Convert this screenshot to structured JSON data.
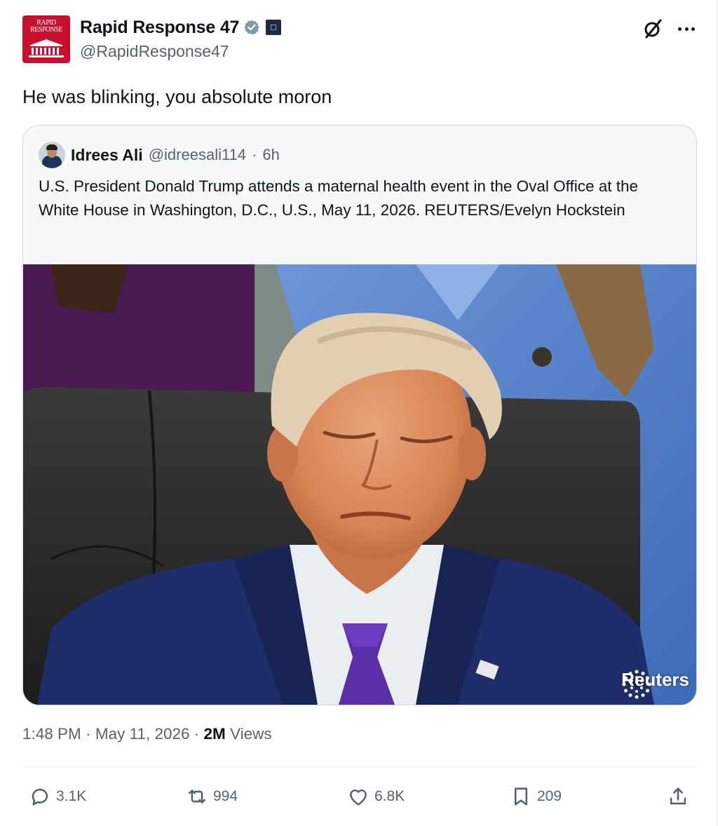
{
  "author": {
    "display_name": "Rapid Response 47",
    "handle": "@RapidResponse47",
    "avatar_text_line1": "RAPID",
    "avatar_text_line2": "RESPONSE"
  },
  "tweet": {
    "text": "He was blinking, you absolute moron"
  },
  "quoted_tweet": {
    "display_name": "Idrees Ali",
    "handle": "@idreesali114",
    "separator": "·",
    "age": "6h",
    "text": "U.S. President Donald Trump attends a maternal health event in the Oval Office at the White House in Washington, D.C., U.S., May 11, 2026. REUTERS/Evelyn Hockstein",
    "watermark": "Reuters"
  },
  "meta": {
    "time": "1:48 PM",
    "date": "May 11, 2026",
    "separator": "·",
    "views_count": "2M",
    "views_label": "Views"
  },
  "actions": {
    "replies": "3.1K",
    "reposts": "994",
    "likes": "6.8K",
    "bookmarks": "209"
  },
  "colors": {
    "text_primary": "#0f1419",
    "text_secondary": "#536471",
    "verified": "#829aab",
    "avatar_bg": "#c8102e",
    "border": "#cfd9de"
  },
  "icons": [
    "verified-badge-icon",
    "affiliate-badge-icon",
    "grok-icon",
    "more-icon",
    "reply-icon",
    "repost-icon",
    "like-icon",
    "bookmark-icon",
    "share-icon",
    "reuters-logo-icon"
  ]
}
